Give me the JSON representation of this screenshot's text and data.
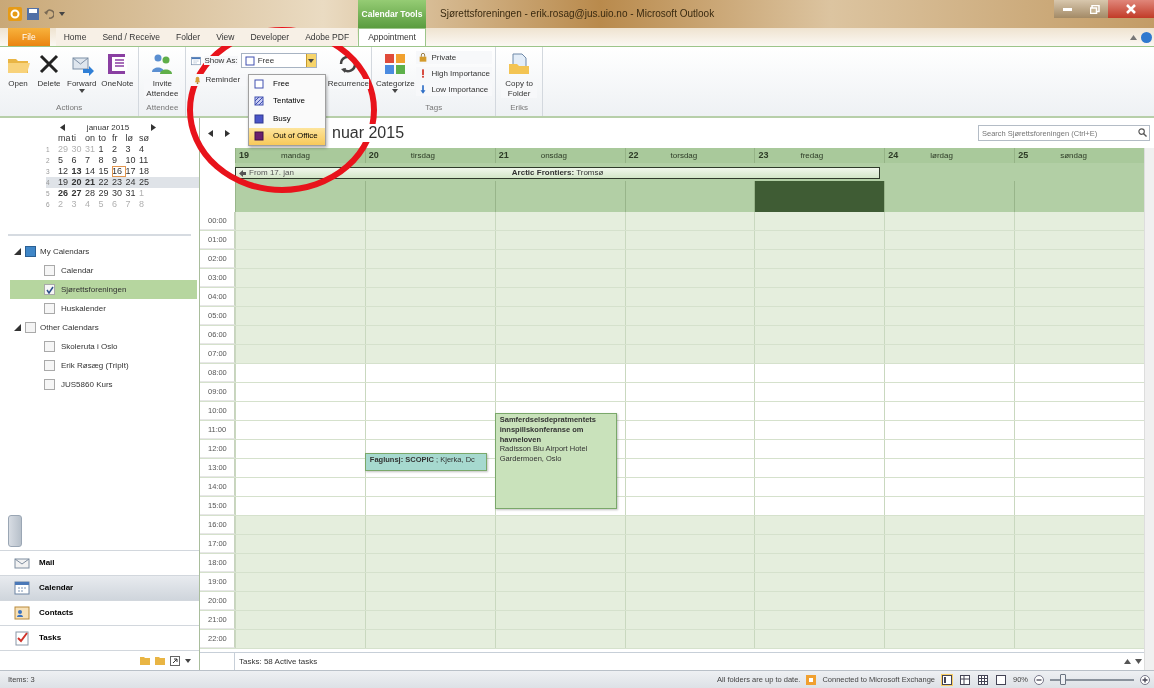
{
  "title_bar": {
    "contextual_tab": "Calendar Tools",
    "title": "Sjørettsforeningen - erik.rosag@jus.uio.no - Microsoft Outlook"
  },
  "tabs": [
    {
      "label": "File",
      "kind": "file",
      "selected": false
    },
    {
      "label": "Home",
      "kind": "tab",
      "selected": false
    },
    {
      "label": "Send / Receive",
      "kind": "tab",
      "selected": false
    },
    {
      "label": "Folder",
      "kind": "tab",
      "selected": false
    },
    {
      "label": "View",
      "kind": "tab",
      "selected": false
    },
    {
      "label": "Developer",
      "kind": "tab",
      "selected": false
    },
    {
      "label": "Adobe PDF",
      "kind": "tab",
      "selected": false
    },
    {
      "label": "Appointment",
      "kind": "contextual",
      "selected": true
    }
  ],
  "ribbon_groups": [
    {
      "kind": "large",
      "label": "Actions",
      "buttons": [
        {
          "label": "Open",
          "kind": "folder"
        },
        {
          "label": "Delete",
          "kind": "delete"
        },
        {
          "label": "Forward",
          "kind": "forward",
          "dropdown": true
        },
        {
          "label": "OneNote",
          "kind": "onenote"
        }
      ]
    },
    {
      "kind": "large",
      "label": "Attendee",
      "buttons": [
        {
          "label": "Invite Attendee",
          "kind": "people"
        }
      ]
    },
    {
      "kind": "options",
      "show_as": {
        "label": "Show As:",
        "value": "Free"
      },
      "reminder": "Reminder",
      "buttons": [
        {
          "label": "Recurrence",
          "kind": "recurrence"
        }
      ]
    },
    {
      "kind": "tags",
      "label": "Tags",
      "buttons": [
        {
          "label": "Categorize",
          "kind": "categorize",
          "dropdown": true
        }
      ],
      "small_buttons": [
        {
          "label": "Private",
          "kind": "lock"
        },
        {
          "label": "High Importance",
          "kind": "high"
        },
        {
          "label": "Low Importance",
          "kind": "low"
        }
      ]
    },
    {
      "kind": "large",
      "label": "Eriks",
      "buttons": [
        {
          "label": "Copy to Folder",
          "kind": "copy"
        }
      ]
    }
  ],
  "show_as_menu": [
    {
      "label": "Free",
      "kind": "free",
      "selected": false
    },
    {
      "label": "Tentative",
      "kind": "tentative",
      "selected": false
    },
    {
      "label": "Busy",
      "kind": "busy",
      "selected": false
    },
    {
      "label": "Out of Office",
      "kind": "oof",
      "selected": true
    }
  ],
  "mini_calendar": {
    "title": "januar 2015",
    "weekdays": [
      "ma",
      "ti",
      "on",
      "to",
      "fr",
      "lø",
      "sø"
    ],
    "weeks": [
      {
        "number": "1",
        "selected": false,
        "days": [
          {
            "label": "29",
            "kind": "other"
          },
          {
            "label": "30",
            "kind": "other"
          },
          {
            "label": "31",
            "kind": "other"
          },
          {
            "label": "1",
            "kind": "normal"
          },
          {
            "label": "2",
            "kind": "normal"
          },
          {
            "label": "3",
            "kind": "normal"
          },
          {
            "label": "4",
            "kind": "normal"
          }
        ]
      },
      {
        "number": "2",
        "selected": false,
        "days": [
          {
            "label": "5",
            "kind": "normal"
          },
          {
            "label": "6",
            "kind": "normal"
          },
          {
            "label": "7",
            "kind": "normal"
          },
          {
            "label": "8",
            "kind": "normal"
          },
          {
            "label": "9",
            "kind": "normal"
          },
          {
            "label": "10",
            "kind": "normal"
          },
          {
            "label": "11",
            "kind": "normal"
          }
        ]
      },
      {
        "number": "3",
        "selected": false,
        "days": [
          {
            "label": "12",
            "kind": "normal"
          },
          {
            "label": "13",
            "kind": "bold"
          },
          {
            "label": "14",
            "kind": "normal"
          },
          {
            "label": "15",
            "kind": "normal"
          },
          {
            "label": "16",
            "kind": "today"
          },
          {
            "label": "17",
            "kind": "normal"
          },
          {
            "label": "18",
            "kind": "normal"
          }
        ]
      },
      {
        "number": "4",
        "selected": true,
        "days": [
          {
            "label": "19",
            "kind": "normal"
          },
          {
            "label": "20",
            "kind": "bold"
          },
          {
            "label": "21",
            "kind": "bold"
          },
          {
            "label": "22",
            "kind": "normal"
          },
          {
            "label": "23",
            "kind": "normal"
          },
          {
            "label": "24",
            "kind": "normal"
          },
          {
            "label": "25",
            "kind": "normal"
          }
        ]
      },
      {
        "number": "5",
        "selected": false,
        "days": [
          {
            "label": "26",
            "kind": "bold"
          },
          {
            "label": "27",
            "kind": "bold"
          },
          {
            "label": "28",
            "kind": "normal"
          },
          {
            "label": "29",
            "kind": "normal"
          },
          {
            "label": "30",
            "kind": "normal"
          },
          {
            "label": "31",
            "kind": "normal"
          },
          {
            "label": "1",
            "kind": "other"
          }
        ]
      },
      {
        "number": "6",
        "selected": false,
        "days": [
          {
            "label": "2",
            "kind": "other"
          },
          {
            "label": "3",
            "kind": "other"
          },
          {
            "label": "4",
            "kind": "other"
          },
          {
            "label": "5",
            "kind": "other"
          },
          {
            "label": "6",
            "kind": "other"
          },
          {
            "label": "7",
            "kind": "other"
          },
          {
            "label": "8",
            "kind": "other"
          }
        ]
      }
    ]
  },
  "calendar_groups": [
    {
      "label": "My Calendars",
      "expanded": true,
      "children": [
        {
          "label": "Calendar",
          "checked": false,
          "selected": false
        },
        {
          "label": "Sjørettsforeningen",
          "checked": true,
          "selected": true
        },
        {
          "label": "Huskalender",
          "checked": false,
          "selected": false
        }
      ]
    },
    {
      "label": "Other Calendars",
      "expanded": true,
      "children": [
        {
          "label": "Skoleruta i Oslo",
          "checked": false,
          "selected": false
        },
        {
          "label": "Erik Røsæg (TripIt)",
          "checked": false,
          "selected": false
        },
        {
          "label": "JUS5860 Kurs",
          "checked": false,
          "selected": false
        }
      ]
    }
  ],
  "nav_buttons": [
    {
      "label": "Mail",
      "kind": "mail",
      "selected": false
    },
    {
      "label": "Calendar",
      "kind": "calendar",
      "selected": true
    },
    {
      "label": "Contacts",
      "kind": "contacts",
      "selected": false
    },
    {
      "label": "Tasks",
      "kind": "tasks",
      "selected": false
    }
  ],
  "calendar": {
    "title": "nuar 2015",
    "search": {
      "placeholder": "Search Sjørettsforeningen (Ctrl+E)"
    },
    "days": [
      {
        "number": "19",
        "name": "mandag",
        "allday_selected": false
      },
      {
        "number": "20",
        "name": "tirsdag",
        "allday_selected": false,
        "appointments": [
          {
            "kind": "inline",
            "title": "**Faglunsj: SCOPIC** ; Kjerka, Dc",
            "color": "#a6d9cf"
          }
        ]
      },
      {
        "number": "21",
        "name": "onsdag",
        "allday_selected": false,
        "appointments": [
          {
            "kind": "block",
            "title": "Samferdselsdepratmentets innspillskonferanse om havneloven",
            "location": "Radisson Blu Airport Hotel Gardermoen, Oslo",
            "color": "#c9e2bb"
          }
        ]
      },
      {
        "number": "22",
        "name": "torsdag",
        "allday_selected": false
      },
      {
        "number": "23",
        "name": "fredag",
        "allday_selected": true
      },
      {
        "number": "24",
        "name": "lørdag",
        "allday_selected": false
      },
      {
        "number": "25",
        "name": "søndag",
        "allday_selected": false
      }
    ],
    "allday_events": [
      {
        "prefix": "From 17. jan",
        "title": "**Arctic Frontiers:** Tromsø"
      }
    ],
    "hours": [
      {
        "label": "00:00",
        "working": false
      },
      {
        "label": "01:00",
        "working": false
      },
      {
        "label": "02:00",
        "working": false
      },
      {
        "label": "03:00",
        "working": false
      },
      {
        "label": "04:00",
        "working": false
      },
      {
        "label": "05:00",
        "working": false
      },
      {
        "label": "06:00",
        "working": false
      },
      {
        "label": "07:00",
        "working": false
      },
      {
        "label": "08:00",
        "working": true
      },
      {
        "label": "09:00",
        "working": true
      },
      {
        "label": "10:00",
        "working": true
      },
      {
        "label": "11:00",
        "working": true
      },
      {
        "label": "12:00",
        "working": true
      },
      {
        "label": "13:00",
        "working": true
      },
      {
        "label": "14:00",
        "working": true
      },
      {
        "label": "15:00",
        "working": true
      },
      {
        "label": "16:00",
        "working": false
      },
      {
        "label": "17:00",
        "working": false
      },
      {
        "label": "18:00",
        "working": false
      },
      {
        "label": "19:00",
        "working": false
      },
      {
        "label": "20:00",
        "working": false
      },
      {
        "label": "21:00",
        "working": false
      },
      {
        "label": "22:00",
        "working": false
      }
    ],
    "tasks_bar": "Tasks: 58 Active tasks"
  },
  "status_bar": {
    "items": "Items: 3",
    "sync": "All folders are up to date.",
    "connection": "Connected to Microsoft Exchange",
    "views": [
      {
        "kind": "normal",
        "selected": true
      },
      {
        "kind": "reading",
        "selected": false
      },
      {
        "kind": "grid",
        "selected": false
      },
      {
        "kind": "single",
        "selected": false
      }
    ],
    "zoom": {
      "label": "90%",
      "level": 0.15
    }
  }
}
